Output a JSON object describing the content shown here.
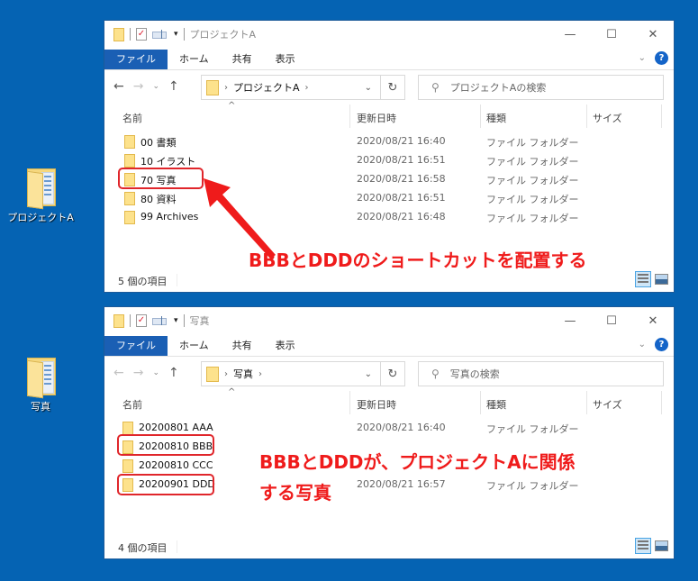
{
  "desktop": {
    "icons": [
      {
        "label": "プロジェクトA",
        "icon": "folder-icon"
      },
      {
        "label": "写真",
        "icon": "folder-icon"
      }
    ],
    "background_color": "#0563b3"
  },
  "windows": [
    {
      "title": "プロジェクトA",
      "ribbon_tabs": [
        "ファイル",
        "ホーム",
        "共有",
        "表示"
      ],
      "breadcrumb": "プロジェクトA",
      "search_placeholder": "プロジェクトAの検索",
      "columns": [
        "名前",
        "更新日時",
        "種類",
        "サイズ"
      ],
      "rows": [
        {
          "name": "00 書類",
          "date": "2020/08/21 16:40",
          "type": "ファイル フォルダー",
          "highlighted": false
        },
        {
          "name": "10 イラスト",
          "date": "2020/08/21 16:51",
          "type": "ファイル フォルダー",
          "highlighted": false
        },
        {
          "name": "70 写真",
          "date": "2020/08/21 16:58",
          "type": "ファイル フォルダー",
          "highlighted": true
        },
        {
          "name": "80 資料",
          "date": "2020/08/21 16:51",
          "type": "ファイル フォルダー",
          "highlighted": false
        },
        {
          "name": "99 Archives",
          "date": "2020/08/21 16:48",
          "type": "ファイル フォルダー",
          "highlighted": false
        }
      ],
      "status": "5 個の項目",
      "annotation": "BBBとDDDのショートカットを配置する"
    },
    {
      "title": "写真",
      "ribbon_tabs": [
        "ファイル",
        "ホーム",
        "共有",
        "表示"
      ],
      "breadcrumb": "写真",
      "search_placeholder": "写真の検索",
      "columns": [
        "名前",
        "更新日時",
        "種類",
        "サイズ"
      ],
      "rows": [
        {
          "name": "20200801 AAA",
          "date": "2020/08/21 16:40",
          "type": "ファイル フォルダー",
          "highlighted": false
        },
        {
          "name": "20200810 BBB",
          "date": "",
          "type": "",
          "highlighted": true
        },
        {
          "name": "20200810 CCC",
          "date": "",
          "type": "",
          "highlighted": false
        },
        {
          "name": "20200901 DDD",
          "date": "2020/08/21 16:57",
          "type": "ファイル フォルダー",
          "highlighted": true
        }
      ],
      "status": "4 個の項目",
      "annotation_line1": "BBBとDDDが、プロジェクトAに関係",
      "annotation_line2": "する写真"
    }
  ],
  "icons": {
    "back": "←",
    "forward": "→",
    "recent": "⌄",
    "up": "↑",
    "refresh": "↻",
    "search": "⚲",
    "minimize": "—",
    "maximize": "☐",
    "close": "✕",
    "expand": "⌄",
    "help": "?",
    "chevron": "›"
  },
  "accent_color": "#1a5fb4",
  "annotation_color": "#ef1b1b"
}
